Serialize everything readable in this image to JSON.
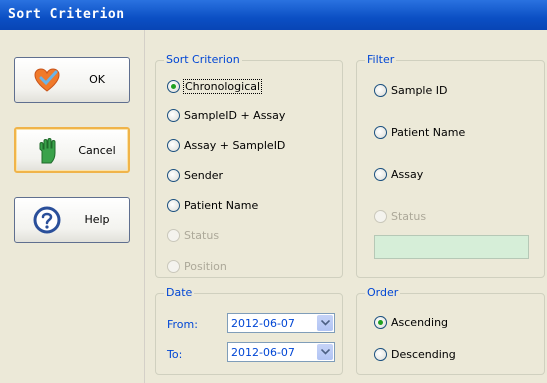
{
  "window": {
    "title": "Sort Criterion"
  },
  "buttons": {
    "ok": {
      "label": "OK",
      "icon": "heart-check-icon"
    },
    "cancel": {
      "label": "Cancel",
      "icon": "raised-hand-icon"
    },
    "help": {
      "label": "Help",
      "icon": "question-icon"
    }
  },
  "sort": {
    "legend": "Sort Criterion",
    "options": [
      {
        "label": "Chronological",
        "checked": true,
        "enabled": true
      },
      {
        "label": "SampleID + Assay",
        "checked": false,
        "enabled": true
      },
      {
        "label": "Assay + SampleID",
        "checked": false,
        "enabled": true
      },
      {
        "label": "Sender",
        "checked": false,
        "enabled": true
      },
      {
        "label": "Patient Name",
        "checked": false,
        "enabled": true
      },
      {
        "label": "Status",
        "checked": false,
        "enabled": false
      },
      {
        "label": "Position",
        "checked": false,
        "enabled": false
      }
    ]
  },
  "filter": {
    "legend": "Filter",
    "options": [
      {
        "label": "Sample ID",
        "enabled": true
      },
      {
        "label": "Patient Name",
        "enabled": true
      },
      {
        "label": "Assay",
        "enabled": true
      },
      {
        "label": "Status",
        "enabled": false
      }
    ],
    "status_value": ""
  },
  "date": {
    "legend": "Date",
    "from_label": "From:",
    "from_value": "2012-06-07",
    "to_label": "To:",
    "to_value": "2012-06-07"
  },
  "order": {
    "legend": "Order",
    "ascending": "Ascending",
    "descending": "Descending",
    "selected": "Ascending"
  },
  "colors": {
    "title_bar": "#0b4fc4",
    "legend_text": "#0046d5",
    "status_box": "#d6eed8"
  }
}
